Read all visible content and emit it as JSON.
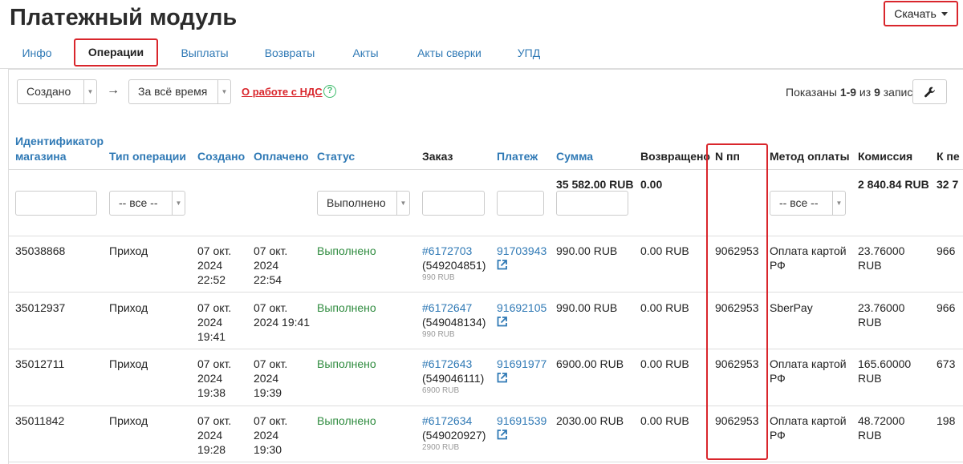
{
  "page_title": "Платежный модуль",
  "download": {
    "label": "Скачать"
  },
  "tabs": [
    {
      "label": "Инфо"
    },
    {
      "label": "Операции"
    },
    {
      "label": "Выплаты"
    },
    {
      "label": "Возвраты"
    },
    {
      "label": "Акты"
    },
    {
      "label": "Акты сверки"
    },
    {
      "label": "УПД"
    }
  ],
  "filters": {
    "date_field": "Создано",
    "period": "За всё время",
    "vat_link": "О работе с НДС",
    "help_icon": "question-circle-icon",
    "shown_prefix": "Показаны ",
    "shown_range": "1-9",
    "shown_mid": " из ",
    "shown_total": "9",
    "shown_suffix": " записи.",
    "settings_icon": "wrench-icon"
  },
  "columns": {
    "shop_id_line1": "Идентификатор",
    "shop_id_line2": "магазина",
    "op_type": "Тип операции",
    "created": "Создано",
    "paid": "Оплачено",
    "status": "Статус",
    "order": "Заказ",
    "payment": "Платеж",
    "amount": "Сумма",
    "refunded": "Возвращено",
    "npp": "N пп",
    "method": "Метод оплаты",
    "commission": "Комиссия",
    "payout": "К пе"
  },
  "column_filters": {
    "op_type": "-- все --",
    "status": "Выполнено",
    "method": "-- все --"
  },
  "totals": {
    "amount": "35 582.00 RUB",
    "refunded": "0.00",
    "commission": "2 840.84 RUB",
    "payout": "32 7"
  },
  "rows": [
    {
      "shop_id": "35038868",
      "op_type": "Приход",
      "created_1": "07 окт.",
      "created_2": "2024",
      "created_3": "22:52",
      "paid_1": "07 окт.",
      "paid_2": "2024",
      "paid_3": "22:54",
      "status": "Выполнено",
      "order_link": "#6172703",
      "order_id": "(549204851)",
      "order_sum": "990 RUB",
      "payment": "91703943",
      "amount": "990.00 RUB",
      "refunded": "0.00 RUB",
      "npp": "9062953",
      "method_1": "Оплата картой",
      "method_2": "РФ",
      "commission_1": "23.76000",
      "commission_2": "RUB",
      "payout": "966"
    },
    {
      "shop_id": "35012937",
      "op_type": "Приход",
      "created_1": "07 окт.",
      "created_2": "2024",
      "created_3": "19:41",
      "paid_1": "07 окт.",
      "paid_2": "2024 19:41",
      "paid_3": "",
      "status": "Выполнено",
      "order_link": "#6172647",
      "order_id": "(549048134)",
      "order_sum": "990 RUB",
      "payment": "91692105",
      "amount": "990.00 RUB",
      "refunded": "0.00 RUB",
      "npp": "9062953",
      "method_1": "SberPay",
      "method_2": "",
      "commission_1": "23.76000",
      "commission_2": "RUB",
      "payout": "966"
    },
    {
      "shop_id": "35012711",
      "op_type": "Приход",
      "created_1": "07 окт.",
      "created_2": "2024",
      "created_3": "19:38",
      "paid_1": "07 окт.",
      "paid_2": "2024",
      "paid_3": "19:39",
      "status": "Выполнено",
      "order_link": "#6172643",
      "order_id": "(549046111)",
      "order_sum": "6900 RUB",
      "payment": "91691977",
      "amount": "6900.00 RUB",
      "refunded": "0.00 RUB",
      "npp": "9062953",
      "method_1": "Оплата картой",
      "method_2": "РФ",
      "commission_1": "165.60000",
      "commission_2": "RUB",
      "payout": "673"
    },
    {
      "shop_id": "35011842",
      "op_type": "Приход",
      "created_1": "07 окт.",
      "created_2": "2024",
      "created_3": "19:28",
      "paid_1": "07 окт.",
      "paid_2": "2024",
      "paid_3": "19:30",
      "status": "Выполнено",
      "order_link": "#6172634",
      "order_id": "(549020927)",
      "order_sum": "2900 RUB",
      "payment": "91691539",
      "amount": "2030.00 RUB",
      "refunded": "0.00 RUB",
      "npp": "9062953",
      "method_1": "Оплата картой",
      "method_2": "РФ",
      "commission_1": "48.72000",
      "commission_2": "RUB",
      "payout": "198"
    }
  ]
}
